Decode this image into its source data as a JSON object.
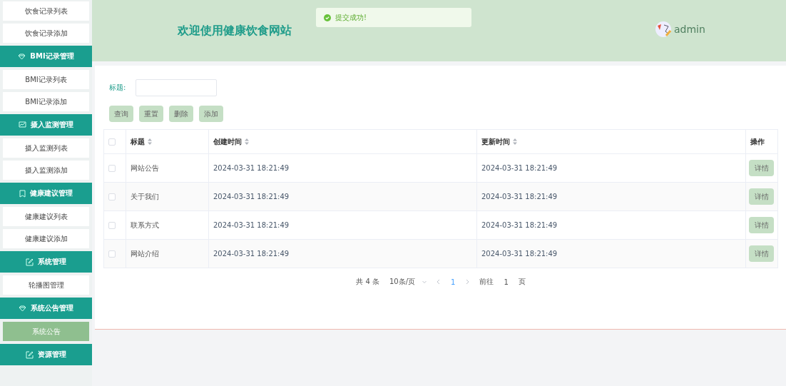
{
  "sidebar": {
    "items": [
      {
        "kind": "item",
        "label": "饮食记录列表",
        "selected": false
      },
      {
        "kind": "item",
        "label": "饮食记录添加",
        "selected": false
      },
      {
        "kind": "group",
        "label": "BMI记录管理"
      },
      {
        "kind": "item",
        "label": "BMI记录列表",
        "selected": false
      },
      {
        "kind": "item",
        "label": "BMI记录添加",
        "selected": false
      },
      {
        "kind": "group",
        "label": "摄入监测管理"
      },
      {
        "kind": "item",
        "label": "摄入监测列表",
        "selected": false
      },
      {
        "kind": "item",
        "label": "摄入监测添加",
        "selected": false
      },
      {
        "kind": "group",
        "label": "健康建议管理"
      },
      {
        "kind": "item",
        "label": "健康建议列表",
        "selected": false
      },
      {
        "kind": "item",
        "label": "健康建议添加",
        "selected": false
      },
      {
        "kind": "group",
        "label": "系统管理"
      },
      {
        "kind": "item",
        "label": "轮播图管理",
        "selected": false
      },
      {
        "kind": "group",
        "label": "系统公告管理"
      },
      {
        "kind": "item",
        "label": "系统公告",
        "selected": true
      },
      {
        "kind": "group",
        "label": "资源管理"
      }
    ]
  },
  "header": {
    "title": "欢迎使用健康饮食网站",
    "toast": "提交成功!",
    "user": "admin"
  },
  "search": {
    "label": "标题:"
  },
  "buttons": [
    "查询",
    "重置",
    "删除",
    "添加"
  ],
  "table": {
    "all_checked": false,
    "columns": [
      {
        "label": "标题",
        "sortable": true
      },
      {
        "label": "创建时间",
        "sortable": true
      },
      {
        "label": "更新时间",
        "sortable": true
      },
      {
        "label": "操作",
        "sortable": false
      }
    ],
    "rows": [
      {
        "checked": false,
        "title": "网站公告",
        "created": "2024-03-31 18:21:49",
        "updated": "2024-03-31 18:21:49",
        "action": "详情"
      },
      {
        "checked": false,
        "title": "关于我们",
        "created": "2024-03-31 18:21:49",
        "updated": "2024-03-31 18:21:49",
        "action": "详情"
      },
      {
        "checked": false,
        "title": "联系方式",
        "created": "2024-03-31 18:21:49",
        "updated": "2024-03-31 18:21:49",
        "action": "详情"
      },
      {
        "checked": false,
        "title": "网站介绍",
        "created": "2024-03-31 18:21:49",
        "updated": "2024-03-31 18:21:49",
        "action": "详情"
      }
    ]
  },
  "pagination": {
    "total": "共 4 条",
    "page_size": "10条/页",
    "pages": [
      {
        "label": "1",
        "selected": true
      }
    ],
    "goto_label": "前往",
    "goto_value": "1",
    "goto_suffix": "页"
  }
}
